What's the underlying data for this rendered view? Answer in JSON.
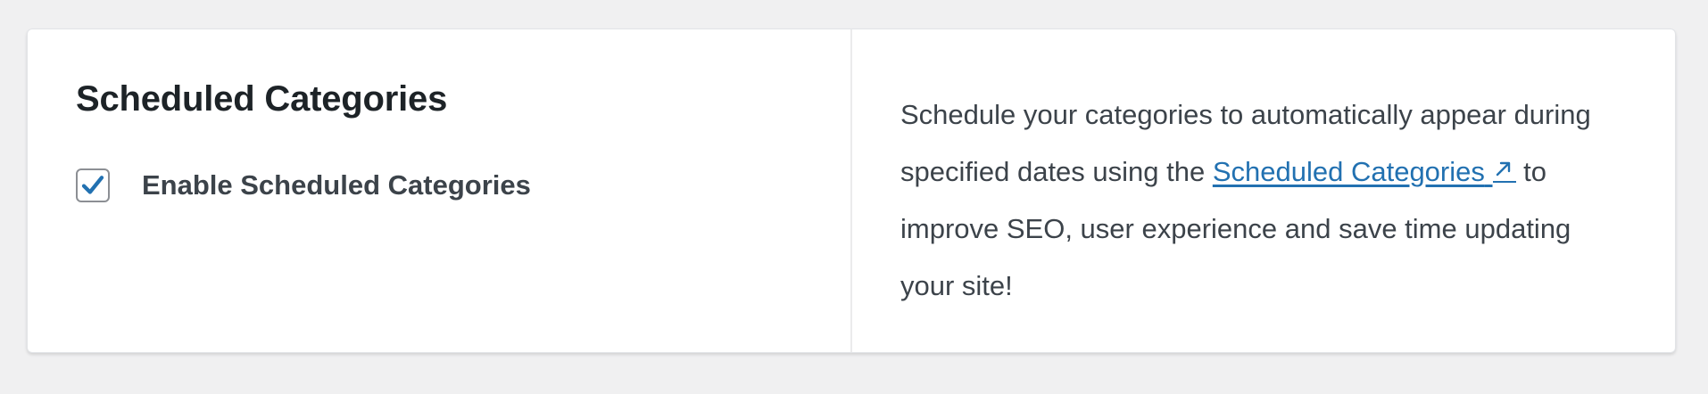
{
  "section": {
    "title": "Scheduled Categories"
  },
  "setting": {
    "checkbox_label": "Enable Scheduled Categories",
    "checked": true
  },
  "description": {
    "before_link": "Schedule your categories to automatically appear during specified dates using the ",
    "link_text": "Scheduled Categories",
    "after_link": " to improve SEO, user experience and save time updating your site!",
    "link_icon": "external-link-arrow-icon"
  },
  "colors": {
    "accent": "#2271b1",
    "background": "#f0f0f1",
    "card": "#ffffff",
    "text": "#3c434a",
    "heading": "#1d2327"
  }
}
